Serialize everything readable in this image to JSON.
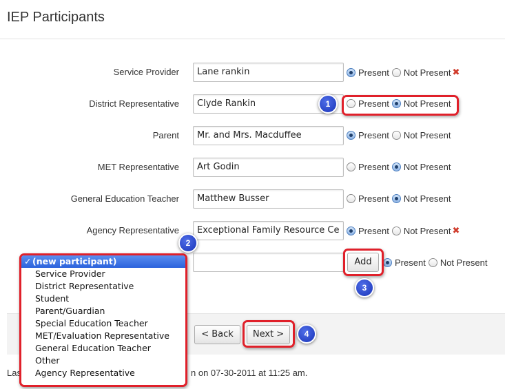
{
  "page": {
    "title": "IEP Participants"
  },
  "participants": [
    {
      "label": "Service Provider",
      "value": "Lane rankin",
      "status": "Present",
      "removable": true
    },
    {
      "label": "District Representative",
      "value": "Clyde Rankin",
      "status": "Not Present",
      "removable": false
    },
    {
      "label": "Parent",
      "value": "Mr. and Mrs. Macduffee",
      "status": "Present",
      "removable": false
    },
    {
      "label": "MET Representative",
      "value": "Art Godin",
      "status": "Not Present",
      "removable": false
    },
    {
      "label": "General Education Teacher",
      "value": "Matthew Busser",
      "status": "Not Present",
      "removable": false
    },
    {
      "label": "Agency Representative",
      "value": "Exceptional Family Resource Ce",
      "status": "Present",
      "removable": true
    }
  ],
  "options": {
    "present": "Present",
    "not_present": "Not Present",
    "remove_glyph": "✖"
  },
  "new_participant": {
    "value": "",
    "add_label": "Add",
    "status": "Present",
    "dropdown": {
      "selected_mark": "✓",
      "items": [
        "(new participant)",
        "Service Provider",
        "District Representative",
        "Student",
        "Parent/Guardian",
        "Special Education Teacher",
        "MET/Evaluation Representative",
        "General Education Teacher",
        "Other",
        "Agency Representative"
      ]
    }
  },
  "nav": {
    "back_label": "< Back",
    "next_label": "Next >"
  },
  "footer": {
    "prefix": "Las",
    "suffix": "n on 07-30-2011 at 11:25 am."
  },
  "callouts": {
    "one": "1",
    "two": "2",
    "three": "3",
    "four": "4"
  },
  "colors": {
    "callout": "#e0202a",
    "badge": "#1f3dc4",
    "selection": "#3a72e6"
  }
}
